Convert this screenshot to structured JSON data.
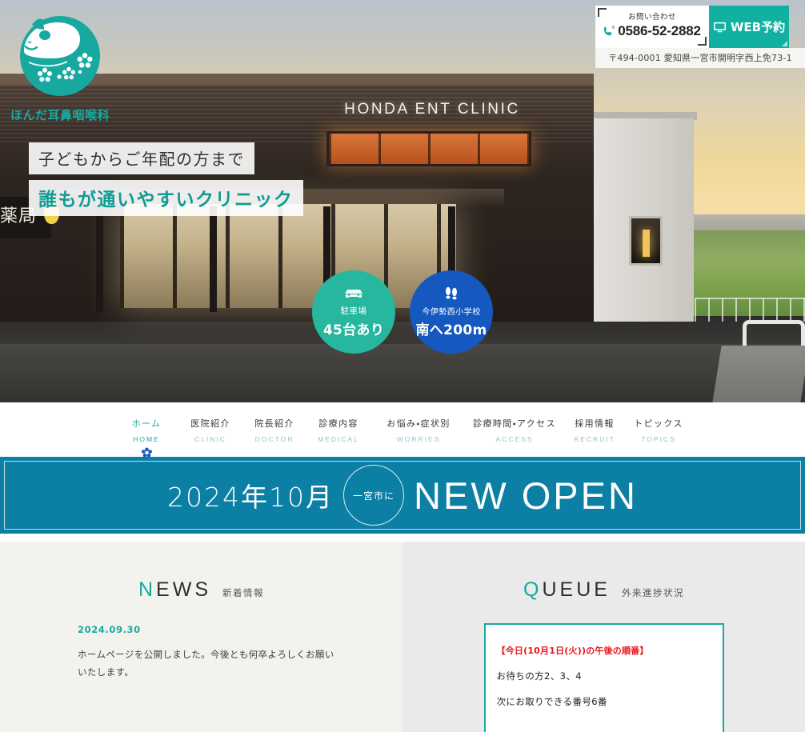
{
  "site": {
    "logo_name": "ほんだ耳鼻咽喉科",
    "logo_icon": "panda-flower-logo",
    "brand_teal": "#17a9a0",
    "banner_blue": "#0b7fa4",
    "accent_blue": "#1559c0",
    "alert_red": "#e8141c"
  },
  "header": {
    "tel_label": "お問い合わせ",
    "tel_number": "0586-52-2882",
    "tel_icon": "phone-icon",
    "web_reserve_label": "WEB予約",
    "web_reserve_icon": "monitor-icon",
    "address": "〒494-0001 愛知県一宮市開明字西上免73-1"
  },
  "hero": {
    "building_sign": "HONDA ENT CLINIC",
    "pharmacy_sign": "薬局",
    "catch_line_1": "子どもからご年配の方まで",
    "catch_line_2": "誰もが通いやすいクリニック",
    "badges": [
      {
        "icon": "car-icon",
        "sub": "駐車場",
        "main": "45台あり",
        "color": "#26b79e"
      },
      {
        "icon": "footprints-icon",
        "sub": "今伊勢西小学校",
        "main": "南へ200m",
        "color": "#1559c0"
      }
    ]
  },
  "nav": {
    "items": [
      {
        "ja": "ホーム",
        "en": "HOME",
        "active": true
      },
      {
        "ja": "医院紹介",
        "en": "CLINIC",
        "active": false
      },
      {
        "ja": "院長紹介",
        "en": "DOCTOR",
        "active": false
      },
      {
        "ja": "診療内容",
        "en": "MEDICAL",
        "active": false
      },
      {
        "ja": "お悩み・症状別",
        "en": "WORRIES",
        "active": false
      },
      {
        "ja": "診療時間・アクセス",
        "en": "ACCESS",
        "active": false
      },
      {
        "ja": "採用情報",
        "en": "RECRUIT",
        "active": false
      },
      {
        "ja": "トピックス",
        "en": "TOPICS",
        "active": false
      }
    ],
    "active_marker_icon": "flower-icon"
  },
  "banner": {
    "date": "2024年10月",
    "circle_text": "一宮市に",
    "headline": "NEW OPEN"
  },
  "news": {
    "heading_first": "N",
    "heading_rest": "EWS",
    "heading_ja": "新着情報",
    "items": [
      {
        "date": "2024.09.30",
        "text": "ホームページを公開しました。今後とも何卒よろしくお願いいたします。"
      }
    ]
  },
  "queue": {
    "heading_first": "Q",
    "heading_rest": "UEUE",
    "heading_ja": "外来進捗状況",
    "title": "【今日(10月1日(火))の午後の順番】",
    "waiting_line": "お待ちの方2、3、4",
    "next_line": "次にお取りできる番号6番"
  }
}
